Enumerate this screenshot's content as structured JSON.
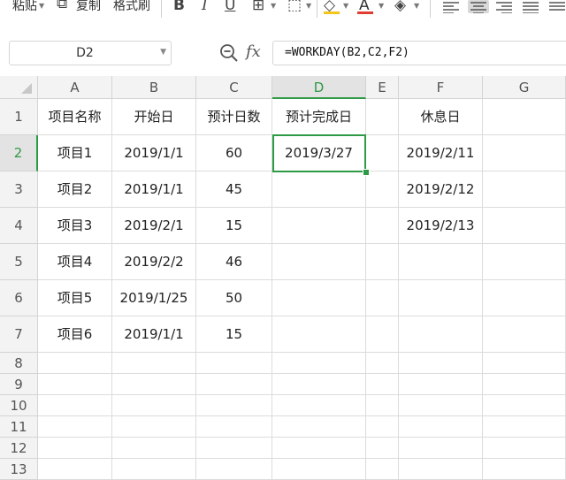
{
  "toolbar": {
    "paste_label": "粘贴",
    "copy_label": "复制",
    "format_painter_label": "格式刷",
    "bold_label": "B",
    "italic_label": "I",
    "underline_label": "U",
    "font_color_label": "A",
    "font_color_bar": "#e03c31",
    "fill_color_bar": "#f5c518"
  },
  "formula_bar": {
    "name_box": "D2",
    "fx_label": "fx",
    "formula": "=WORKDAY(B2,C2,F2)"
  },
  "columns": [
    "A",
    "B",
    "C",
    "D",
    "E",
    "F",
    "G"
  ],
  "selected_column": "D",
  "rows": [
    "1",
    "2",
    "3",
    "4",
    "5",
    "6",
    "7",
    "8",
    "9",
    "10",
    "11",
    "12",
    "13"
  ],
  "selected_row": "2",
  "cells": [
    [
      "项目名称",
      "开始日",
      "预计日数",
      "预计完成日",
      "",
      "休息日",
      ""
    ],
    [
      "项目1",
      "2019/1/1",
      "60",
      "2019/3/27",
      "",
      "2019/2/11",
      ""
    ],
    [
      "项目2",
      "2019/1/1",
      "45",
      "",
      "",
      "2019/2/12",
      ""
    ],
    [
      "项目3",
      "2019/2/1",
      "15",
      "",
      "",
      "2019/2/13",
      ""
    ],
    [
      "项目4",
      "2019/2/2",
      "46",
      "",
      "",
      "",
      ""
    ],
    [
      "项目5",
      "2019/1/25",
      "50",
      "",
      "",
      "",
      ""
    ],
    [
      "项目6",
      "2019/1/1",
      "15",
      "",
      "",
      "",
      ""
    ]
  ],
  "colors": {
    "selection": "#2f9a45",
    "header_bg": "#f3f3f3",
    "grid_line": "#dcdcdc"
  }
}
